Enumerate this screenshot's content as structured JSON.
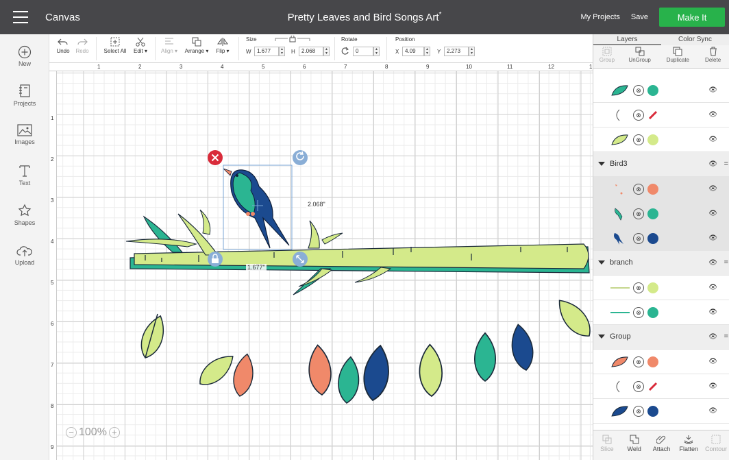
{
  "topbar": {
    "app_name": "Canvas",
    "doc_title": "Pretty Leaves and Bird Songs Art",
    "unsaved_mark": "*",
    "my_projects": "My Projects",
    "save": "Save",
    "make_it": "Make It",
    "make_it_color": "#28b24b"
  },
  "sidebar": {
    "items": [
      {
        "label": "New",
        "icon": "plus-circle-icon"
      },
      {
        "label": "Projects",
        "icon": "projects-icon"
      },
      {
        "label": "Images",
        "icon": "image-icon"
      },
      {
        "label": "Text",
        "icon": "text-icon"
      },
      {
        "label": "Shapes",
        "icon": "shapes-icon"
      },
      {
        "label": "Upload",
        "icon": "upload-cloud-icon"
      }
    ]
  },
  "toolbar": {
    "undo": "Undo",
    "redo": "Redo",
    "select_all": "Select All",
    "edit": "Edit ▾",
    "align": "Align ▾",
    "arrange": "Arrange ▾",
    "flip": "Flip ▾",
    "size_label": "Size",
    "w_label": "W",
    "w_value": "1.677",
    "h_label": "H",
    "h_value": "2.068",
    "rotate_label": "Rotate",
    "rotate_value": "0",
    "position_label": "Position",
    "x_label": "X",
    "x_value": "4.09",
    "y_label": "Y",
    "y_value": "2.273"
  },
  "ruler": {
    "top": [
      "1",
      "2",
      "3",
      "4",
      "5",
      "6",
      "7",
      "8",
      "9",
      "10",
      "11",
      "12",
      "1"
    ],
    "left": [
      "1",
      "2",
      "3",
      "4",
      "5",
      "6",
      "7",
      "8",
      "9"
    ]
  },
  "canvas": {
    "width_label": "1.677\"",
    "height_label": "2.068\"",
    "zoom": "100%",
    "zoom_minus": "−",
    "zoom_plus": "+"
  },
  "panel": {
    "tabs": [
      "Layers",
      "Color Sync"
    ],
    "actions": [
      {
        "label": "Group",
        "disabled": true
      },
      {
        "label": "UnGroup",
        "disabled": false
      },
      {
        "label": "Duplicate",
        "disabled": false
      },
      {
        "label": "Delete",
        "disabled": false
      }
    ],
    "op_symbol": "⊗",
    "eye_symbol": "👁",
    "layers": [
      {
        "kind": "item",
        "thumb": "leaf-teal",
        "color": "#2bb592"
      },
      {
        "kind": "item",
        "thumb": "stroke",
        "color": "red-slash"
      },
      {
        "kind": "item",
        "thumb": "leaf-lime",
        "color": "#d4ea8a"
      },
      {
        "kind": "group",
        "name": "Bird3"
      },
      {
        "kind": "item",
        "thumb": "beak",
        "color": "#f0896a",
        "selected": true
      },
      {
        "kind": "item",
        "thumb": "wing",
        "color": "#2bb592",
        "selected": true
      },
      {
        "kind": "item",
        "thumb": "bird",
        "color": "#1b4a8f",
        "selected": true
      },
      {
        "kind": "group",
        "name": "branch"
      },
      {
        "kind": "item",
        "thumb": "branch-lime",
        "color": "#d4ea8a"
      },
      {
        "kind": "item",
        "thumb": "branch-teal",
        "color": "#2bb592"
      },
      {
        "kind": "group",
        "name": "Group"
      },
      {
        "kind": "item",
        "thumb": "leaf-coral",
        "color": "#f0896a"
      },
      {
        "kind": "item",
        "thumb": "stroke",
        "color": "red-slash"
      },
      {
        "kind": "item",
        "thumb": "leaf-navy",
        "color": "#1b4a8f"
      }
    ],
    "bottom": [
      {
        "label": "Slice",
        "disabled": true
      },
      {
        "label": "Weld",
        "disabled": false
      },
      {
        "label": "Attach",
        "disabled": false
      },
      {
        "label": "Flatten",
        "disabled": false
      },
      {
        "label": "Contour",
        "disabled": true
      }
    ]
  }
}
